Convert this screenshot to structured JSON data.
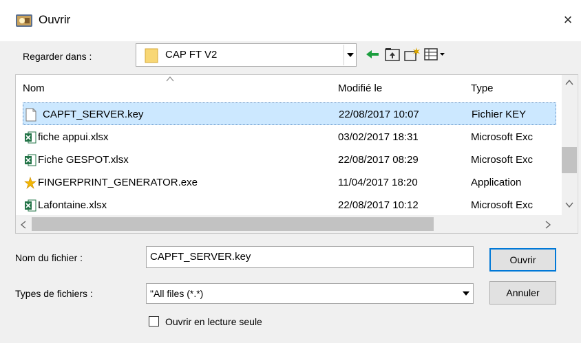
{
  "window": {
    "title": "Ouvrir",
    "close_glyph": "×"
  },
  "look_in": {
    "label": "Regarder dans :",
    "value": "CAP FT V2"
  },
  "list": {
    "columns": [
      "Nom",
      "Modifié le",
      "Type"
    ],
    "rows": [
      {
        "name": "CAPFT_SERVER.key",
        "modified": "22/08/2017 10:07",
        "type": "Fichier KEY",
        "icon": "file-icon",
        "selected": true
      },
      {
        "name": "fiche appui.xlsx",
        "modified": "03/02/2017 18:31",
        "type": "Microsoft Exc",
        "icon": "excel-icon"
      },
      {
        "name": "Fiche GESPOT.xlsx",
        "modified": "22/08/2017 08:29",
        "type": "Microsoft Exc",
        "icon": "excel-icon"
      },
      {
        "name": "FINGERPRINT_GENERATOR.exe",
        "modified": "11/04/2017 18:20",
        "type": "Application",
        "icon": "application-icon"
      },
      {
        "name": "Lafontaine.xlsx",
        "modified": "22/08/2017 10:12",
        "type": "Microsoft Exc",
        "icon": "excel-icon"
      }
    ]
  },
  "filename": {
    "label": "Nom du fichier :",
    "value": "CAPFT_SERVER.key"
  },
  "filetype": {
    "label": "Types de fichiers :",
    "value": "\"All files (*.*)"
  },
  "buttons": {
    "open": "Ouvrir",
    "cancel": "Annuler"
  },
  "readonly": {
    "label": "Ouvrir en lecture seule",
    "checked": false
  },
  "colors": {
    "selection": "#cce8ff",
    "excel_green": "#217346",
    "folder_yellow": "#f8d775"
  }
}
